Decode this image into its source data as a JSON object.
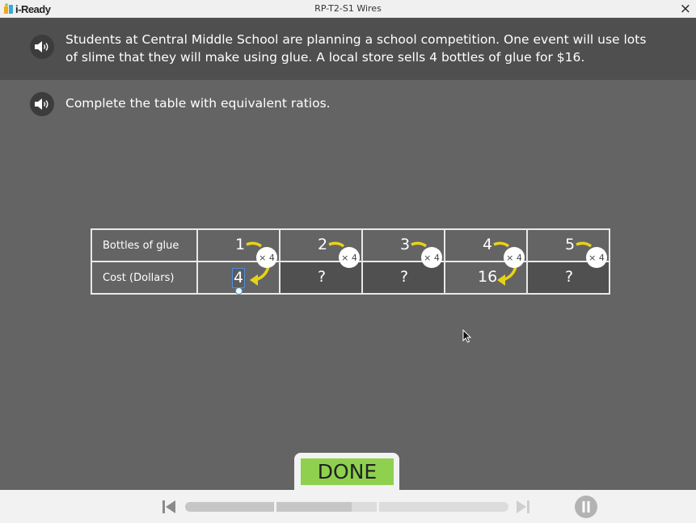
{
  "window": {
    "logo": "i-Ready",
    "title": "RP-T2-S1 Wires",
    "close": "×"
  },
  "problem": {
    "text": "Students at Central Middle School are planning a school competition. One event will use lots of slime that they will make using glue. A local store sells 4 bottles of glue for $16.",
    "instruction": "Complete the table with equivalent ratios."
  },
  "table": {
    "row1_label": "Bottles of glue",
    "row2_label": "Cost (Dollars)",
    "multiplier": "× 4",
    "bottles": [
      "1",
      "2",
      "3",
      "4",
      "5"
    ],
    "costs": [
      "4",
      "?",
      "?",
      "16",
      "?"
    ]
  },
  "done_label": "DONE",
  "colors": {
    "accent_green": "#8fd14f",
    "arrow_yellow": "#e8d21a",
    "input_focus": "#4a90e2"
  }
}
